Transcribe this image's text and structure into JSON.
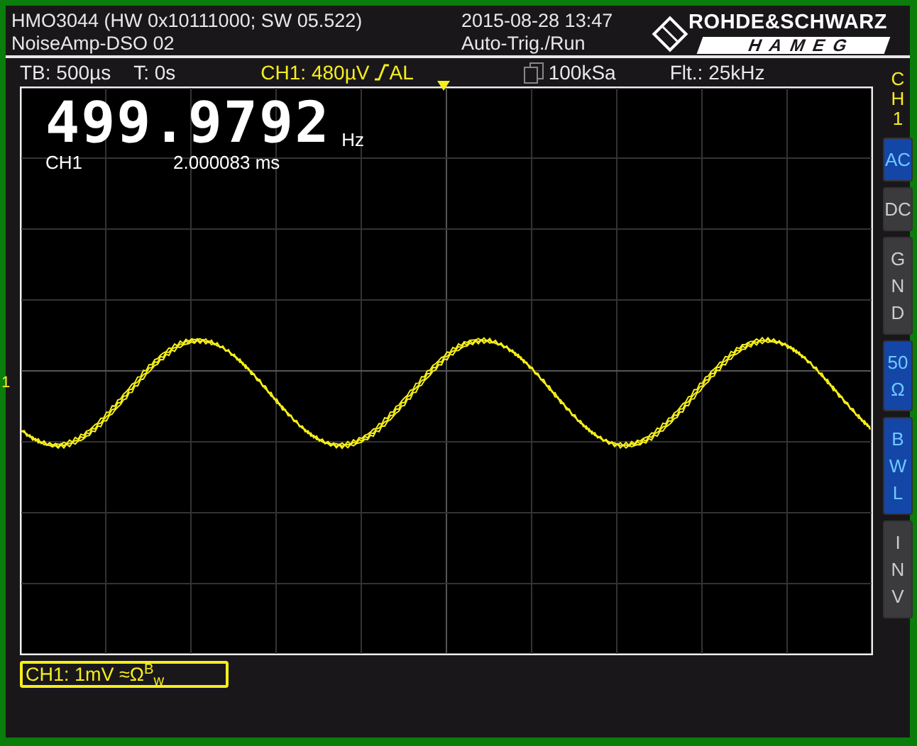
{
  "header": {
    "title": "HMO3044 (HW 0x10111000; SW 05.522)",
    "subtitle": "NoiseAmp-DSO 02",
    "datetime": "2015-08-28 13:47",
    "trigger_mode": "Auto-Trig./Run",
    "logo_top": "ROHDE&SCHWARZ",
    "logo_bottom": "HAMEG"
  },
  "info_bar": {
    "timebase": "TB: 500µs",
    "trigger_time": "T: 0s",
    "trigger_level": "CH1: 480µV",
    "trigger_type": "AL",
    "sample_rate": "100kSa",
    "filter": "Flt.: 25kHz"
  },
  "measurement": {
    "value": "499.9792",
    "unit": "Hz",
    "channel": "CH1",
    "period": "2.000083 ms"
  },
  "channel_marker": "1",
  "channel_label": "CH1: 1mV ≈Ω$^{B}$$_{w}$",
  "side_menu": {
    "title": [
      "C",
      "H",
      "1"
    ],
    "buttons": [
      {
        "lines": [
          "AC"
        ],
        "on": true
      },
      {
        "lines": [
          "DC"
        ],
        "on": false
      },
      {
        "lines": [
          "G",
          "N",
          "D"
        ],
        "on": false
      },
      {
        "lines": [
          "50",
          "Ω"
        ],
        "on": true
      },
      {
        "lines": [
          "B",
          "W",
          "L"
        ],
        "on": true
      },
      {
        "lines": [
          "I",
          "N",
          "V"
        ],
        "on": false
      }
    ]
  }
}
